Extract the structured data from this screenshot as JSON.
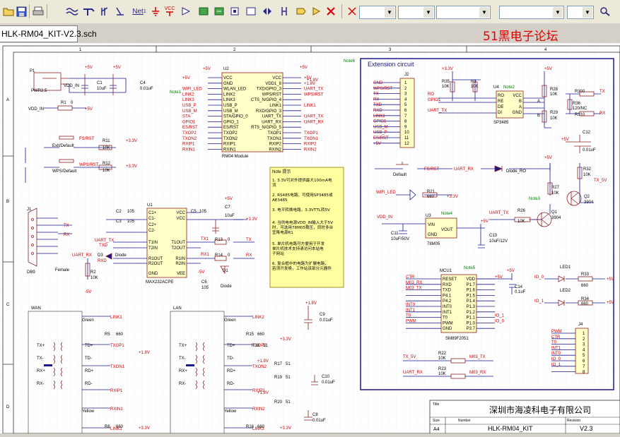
{
  "toolbar": {
    "icons": [
      "folder-open-icon",
      "save-icon",
      "print-icon",
      "wire-icon",
      "bus-icon",
      "bus-entry-icon",
      "net-label-icon",
      "power-port-icon",
      "ground-icon",
      "vcc-icon",
      "part-icon",
      "sheet-symbol-icon",
      "sheet-entry-icon",
      "port-icon",
      "no-erc-icon",
      "directive-icon",
      "cross-icon"
    ],
    "vcc_label": "VCC",
    "net_label": "Net"
  },
  "tab": {
    "label": "HLK-RM04_KIT-V2.3.sch"
  },
  "forum_watermark": "51黑电子论坛",
  "sheet": {
    "border_numbers": [
      "1",
      "2",
      "3",
      "4"
    ],
    "border_letters": [
      "A",
      "B",
      "C",
      "D"
    ],
    "notes": {
      "note6": "Note6",
      "note1": "Note1",
      "note2": "Note2",
      "note3": "Note3",
      "note4": "Note4",
      "note5": "Note5"
    },
    "ext_title": "Extension circuit",
    "note_box": {
      "title": "Note 提示",
      "lines": [
        "1. 3.3V可对外提供最大100mA电",
        "流",
        "2. RS485电路，可使用SP3485或",
        "AE3485",
        "3. 电平转换电路，3.3VTTL转5V",
        "4. 当供电电源VDD_IN输入大于5V",
        "时，可选用78M05稳压，同时多台",
        "宜降电源R1",
        "5. 单片机电路可方便用于开发",
        "单片机技术支持请访问本站电",
        "子网站",
        "6. 复合框中的电路为扩展电路，",
        "若须开发唤，工作站该部分元器件"
      ]
    },
    "p1": {
      "ref": "P1",
      "label": "PWR2.5",
      "vdd": "VDD_IN"
    },
    "c1": {
      "ref": "C1",
      "val": "10uF"
    },
    "c4": {
      "ref": "C4",
      "val": "0.01uF"
    },
    "r1": {
      "ref": "R1",
      "val": "0"
    },
    "vdd_in2": "VDD_IN",
    "plus5v": "+5V",
    "plus3v3": "+3.3V",
    "plus1v8": "+1.8V",
    "exit_default": "Exit/Default",
    "fs_rst": "FS/RST",
    "wps_default": "WPS/Default",
    "wps_rst": "WPS/RST",
    "r11": {
      "ref": "R11",
      "val": "10K"
    },
    "r12": {
      "ref": "R12",
      "val": "10K"
    },
    "u2": {
      "ref": "U2",
      "name": "RM04 Module",
      "left_pins": [
        "VCC",
        "GND",
        "WLAN_LED",
        "LINK2",
        "LINK3",
        "USB_P",
        "USB_M",
        "STA/GPIO_0",
        "GPIO_1",
        "ES/RST",
        "TXOP2",
        "TXON2",
        "RXIP1",
        "RXIN1"
      ],
      "right_pins": [
        "VCC",
        "VDD1_8",
        "TXD/GPIO_3",
        "WPS/RST",
        "CTS_N/GPIO_4",
        "LINK1",
        "RXD/GPIO_3",
        "UART_TX",
        "UART_RX",
        "RTS_N/GPIO_5",
        "TXOP1",
        "TXON1",
        "RXIP2",
        "RXIN2"
      ],
      "left_nets": [
        "+5V",
        "",
        "WIFI_LED",
        "LINK2",
        "LINK3",
        "USB_P",
        "USB_M",
        "STA",
        "GPIO1",
        "ES/RST",
        "TXOP2",
        "TXON2",
        "RXIP1",
        "RXIN1"
      ],
      "right_nets": [
        "+5V",
        "+1.8V",
        "UART_TX",
        "WPS/RST",
        "",
        "LINK1",
        "",
        "UART_TX",
        "UART_RX",
        "",
        "TXOP1",
        "TXON1",
        "RXIP2",
        "RXIN2"
      ]
    },
    "j1": {
      "ref": "J1",
      "name": "DB9",
      "female": "Female"
    },
    "u1": {
      "ref": "U1",
      "name": "MAX232ACPE",
      "left_pins": [
        "C1+",
        "C1-",
        "C2+",
        "C2-",
        "T1IN",
        "T2IN",
        "R1OUT",
        "R2OUT",
        "GND"
      ],
      "right_pins": [
        "VCC",
        "VCC",
        "",
        "",
        "T1OUT",
        "T2OUT",
        "R1IN",
        "R2IN",
        "VEE"
      ]
    },
    "c2": {
      "ref": "C2",
      "val": "105"
    },
    "c3": {
      "ref": "C3",
      "val": "105"
    },
    "c5": {
      "ref": "C5",
      "val": "105"
    },
    "c6": {
      "ref": "C6",
      "val": "105"
    },
    "c7": {
      "ref": "C7",
      "val": "10uF"
    },
    "r13": {
      "ref": "R13",
      "val": "0"
    },
    "r14": {
      "ref": "R14",
      "val": "0"
    },
    "r2": {
      "ref": "R2",
      "val": "10K"
    },
    "d1": {
      "ref": "D1",
      "val": "Diode"
    },
    "d3": {
      "ref": "D3",
      "val": "Diode"
    },
    "uart_tx": "UART_TX",
    "uart_rx": "UART_RX",
    "tx": "TX",
    "rx": "RX",
    "txd": "TXD",
    "rxd": "RXD",
    "tx1": "TX1",
    "rx1": "RX1",
    "minus5v": "-5V",
    "wan": "WAN",
    "lan": "LAN",
    "green": "Green",
    "yellow": "Yellow",
    "wan_nets": [
      "LINK1",
      "TXOP1",
      "TXON1",
      "RXIP1",
      "RXIN1",
      "LINK1"
    ],
    "lan_nets": [
      "LINK2",
      "TXOP2",
      "TXON2",
      "RXIP2",
      "RXIN2",
      "LINK3"
    ],
    "mag_pins": [
      "TX+",
      "TX-",
      "RX+",
      "RX-"
    ],
    "mag_pins_b": [
      "TD+",
      "TD-",
      "RD+",
      "RD-"
    ],
    "r5": {
      "ref": "R5",
      "val": "660"
    },
    "r6": {
      "ref": "R6",
      "val": "660"
    },
    "r15": {
      "ref": "R15",
      "val": "660"
    },
    "r16": {
      "ref": "R16",
      "val": "660"
    },
    "r17": {
      "ref": "R17",
      "val": "51"
    },
    "r18": {
      "ref": "R18",
      "val": "51"
    },
    "r19": {
      "ref": "R19",
      "val": "51"
    },
    "r20": {
      "ref": "R20",
      "val": "51"
    },
    "c8": {
      "ref": "C8",
      "val": "0.01uF"
    },
    "c9": {
      "ref": "C9",
      "val": "0.01uF"
    },
    "c10": {
      "ref": "C10",
      "val": "0.01uF"
    },
    "j2": {
      "ref": "J2",
      "nets": [
        "GND",
        "WPS/RST",
        "TX",
        "RX",
        "TXD",
        "RXD",
        "LINK1",
        "GPIO1",
        "USB_M",
        "USB_P",
        "ES/RST",
        "+5V"
      ]
    },
    "r35": {
      "ref": "R35",
      "val": "10K"
    },
    "r3": {
      "ref": "R3",
      "val": "10K"
    },
    "u4": {
      "ref": "U4",
      "name": "SP3485",
      "left_pins": [
        "RO",
        "RE",
        "DE",
        "DI"
      ],
      "right_pins": [
        "VCC",
        "B",
        "A",
        "GND"
      ]
    },
    "ro": "RO",
    "gpio1": "GPIO1",
    "a": "A",
    "b": "B",
    "r28": {
      "ref": "R28",
      "val": "10K"
    },
    "r29": {
      "ref": "R29",
      "val": "10K"
    },
    "r30": {
      "ref": "R30",
      "val": "0"
    },
    "r31": {
      "ref": "R31",
      "val": "0"
    },
    "r36": {
      "ref": "R36",
      "val": "120/NC"
    },
    "c12": {
      "ref": "C12",
      "val": "0.01uF"
    },
    "default_label": "Default",
    "d2": {
      "ref": "D2",
      "val": "Diode_RO"
    },
    "r32": {
      "ref": "R32",
      "val": "10K"
    },
    "r27": {
      "ref": "R27",
      "val": "10K"
    },
    "tx_5v": "TX_5V",
    "uart_tx_e": "UART_TX",
    "uart_rx_e": "UART_RX",
    "q1": {
      "ref": "Q1",
      "val": "3904"
    },
    "q2": {
      "ref": "Q2",
      "val": "3904"
    },
    "wifi_led": "WIFI_LED",
    "r21": {
      "ref": "R21",
      "val": "660"
    },
    "r26": {
      "ref": "R26",
      "val": "10K"
    },
    "u3": {
      "ref": "U3",
      "name": "78M05",
      "pins": [
        "VIN",
        "VOUT",
        "GND"
      ]
    },
    "c11": {
      "ref": "C11",
      "val": "10uF/50V"
    },
    "c13": {
      "ref": "C13",
      "val": "10uF/12V"
    },
    "mcu1": {
      "ref": "MCU1",
      "name": "SM89F2051",
      "left_pins": [
        "RESET",
        "RXD",
        "TXD",
        "P4.1",
        "P4.2",
        "INT0",
        "INT1",
        "T0",
        "PWM",
        "GND"
      ],
      "right_pins": [
        "VDD",
        "P1.7",
        "P1.6",
        "P1.5",
        "P1.4",
        "P1.3",
        "P1.2",
        "P1.1",
        "P1.0",
        "P3.7"
      ],
      "left_nets": [
        "CTR",
        "M03_RX",
        "M03_TX",
        "",
        "",
        "INT0",
        "INT1",
        "T0",
        "PWM",
        ""
      ],
      "right_nets": [
        "+5V",
        "",
        "",
        "",
        "",
        "",
        "",
        "IO_1",
        "IO_0",
        ""
      ]
    },
    "c14": {
      "ref": "C14",
      "val": "0.1uF"
    },
    "led1": {
      "ref": "LED1"
    },
    "led2": {
      "ref": "LED2"
    },
    "r33": {
      "ref": "R33",
      "val": "660"
    },
    "r34": {
      "ref": "R34",
      "val": "660"
    },
    "io_0": "IO_0",
    "io_1": "IO_1",
    "j4": {
      "ref": "J4",
      "nets": [
        "PWM",
        "CTR",
        "T0",
        "INT1",
        "INT0",
        "IO_0",
        "IO_1",
        ""
      ],
      "pins": [
        "1",
        "2",
        "3",
        "4",
        "5",
        "6",
        "7",
        "8"
      ]
    },
    "r22": {
      "ref": "R22",
      "val": "10K"
    },
    "r23": {
      "ref": "R23",
      "val": "10K"
    },
    "m03_tx": "M03_TX",
    "m03_rx": "M03_RX",
    "title_block": {
      "company": "深圳市海凌科电子有限公司",
      "title_lbl": "Title",
      "size_lbl": "Size",
      "size": "A4",
      "number_lbl": "Number",
      "number": "HLK-RM04_KIT",
      "revision_lbl": "Revision",
      "revision": "V2.3"
    }
  }
}
